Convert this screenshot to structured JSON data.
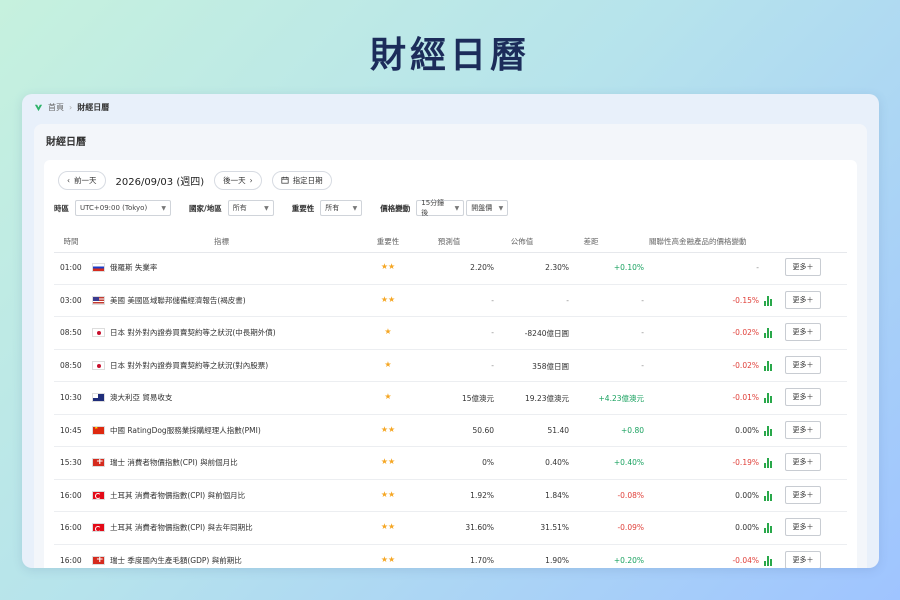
{
  "hero_title": "財經日曆",
  "breadcrumb": {
    "home": "首頁",
    "separator": "›",
    "current": "財經日曆"
  },
  "card_title": "財經日曆",
  "date_nav": {
    "prev": "前一天",
    "date": "2026/09/03 (週四)",
    "next": "後一天",
    "pick": "指定日期"
  },
  "filters": {
    "timezone_label": "時區",
    "timezone_value": "UTC+09:00 (Tokyo)",
    "region_label": "國家/地區",
    "region_value": "所有",
    "importance_label": "重要性",
    "importance_value": "所有",
    "price_label": "價格變動",
    "price_interval": "15分鐘後",
    "price_type": "開盤價"
  },
  "columns": {
    "time": "時間",
    "indicator": "指標",
    "importance": "重要性",
    "forecast": "預測值",
    "actual": "公佈值",
    "diff": "差距",
    "related": "關聯性高金融產品的價格變動"
  },
  "more_label": "更多＋",
  "rows": [
    {
      "time": "01:00",
      "flag": "ru",
      "indicator": "俄羅斯 失業率",
      "stars": "★★",
      "forecast": "2.20%",
      "actual": "2.30%",
      "diff": "+0.10%",
      "change": "-"
    },
    {
      "time": "03:00",
      "flag": "us",
      "indicator": "美國 美國區域聯邦儲備經濟報告(褐皮書)",
      "stars": "★★",
      "forecast": "-",
      "actual": "-",
      "diff": "-",
      "change": "-0.15%"
    },
    {
      "time": "08:50",
      "flag": "jp",
      "indicator": "日本 對外對內證券買賣契約等之狀況(中長期外債)",
      "stars": "★",
      "forecast": "-",
      "actual": "-8240億日圓",
      "diff": "-",
      "change": "-0.02%"
    },
    {
      "time": "08:50",
      "flag": "jp",
      "indicator": "日本 對外對內證券買賣契約等之狀況(對內股票)",
      "stars": "★",
      "forecast": "-",
      "actual": "358億日圓",
      "diff": "-",
      "change": "-0.02%"
    },
    {
      "time": "10:30",
      "flag": "au",
      "indicator": "澳大利亞 貿易收支",
      "stars": "★",
      "forecast": "15億澳元",
      "actual": "19.23億澳元",
      "diff": "+4.23億澳元",
      "change": "-0.01%"
    },
    {
      "time": "10:45",
      "flag": "cn",
      "indicator": "中國 RatingDog服務業採購經理人指數(PMI)",
      "stars": "★★",
      "forecast": "50.60",
      "actual": "51.40",
      "diff": "+0.80",
      "change": "0.00%"
    },
    {
      "time": "15:30",
      "flag": "ch",
      "indicator": "瑞士 消費者物價指數(CPI) 與前個月比",
      "stars": "★★",
      "forecast": "0%",
      "actual": "0.40%",
      "diff": "+0.40%",
      "change": "-0.19%"
    },
    {
      "time": "16:00",
      "flag": "tr",
      "indicator": "土耳其 消費者物價指數(CPI) 與前個月比",
      "stars": "★★",
      "forecast": "1.92%",
      "actual": "1.84%",
      "diff": "-0.08%",
      "change": "0.00%"
    },
    {
      "time": "16:00",
      "flag": "tr",
      "indicator": "土耳其 消費者物價指數(CPI) 與去年同期比",
      "stars": "★★",
      "forecast": "31.60%",
      "actual": "31.51%",
      "diff": "-0.09%",
      "change": "0.00%"
    },
    {
      "time": "16:00",
      "flag": "ch",
      "indicator": "瑞士 季度國內生產毛額(GDP) 與前期比",
      "stars": "★★",
      "forecast": "1.70%",
      "actual": "1.90%",
      "diff": "+0.20%",
      "change": "-0.04%"
    }
  ]
}
